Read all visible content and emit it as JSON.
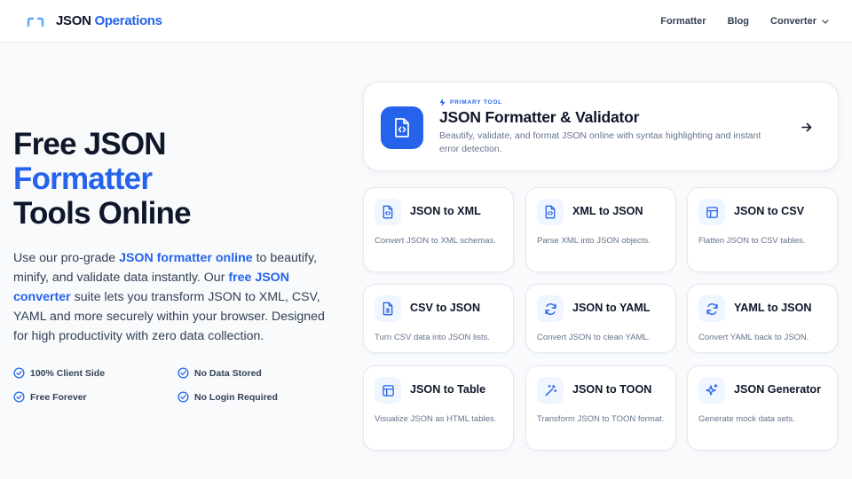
{
  "header": {
    "logo": {
      "prefix": "JSON",
      "accent": "Operations"
    },
    "nav": [
      {
        "label": "Formatter"
      },
      {
        "label": "Blog"
      },
      {
        "label": "Converter"
      }
    ]
  },
  "hero": {
    "title_line1": "Free JSON",
    "title_line2": "Formatter",
    "title_line3": "Tools Online",
    "desc_1": "Use our pro-grade ",
    "desc_link1": "JSON formatter online",
    "desc_2": " to beautify, minify, and validate data instantly. Our ",
    "desc_link2": "free JSON converter",
    "desc_3": " suite lets you transform JSON to XML, CSV, YAML and more securely within your browser. Designed for high productivity with zero data collection.",
    "features": [
      "100% Client Side",
      "No Data Stored",
      "Free Forever",
      "No Login Required"
    ]
  },
  "primary_tool": {
    "tag": "PRIMARY TOOL",
    "title": "JSON Formatter & Validator",
    "description": "Beautify, validate, and format JSON online with syntax highlighting and instant error detection."
  },
  "tools": [
    {
      "title": "JSON to XML",
      "description": "Convert JSON to XML schemas.",
      "icon": "code-file-icon"
    },
    {
      "title": "XML to JSON",
      "description": "Parse XML into JSON objects.",
      "icon": "code-file-icon"
    },
    {
      "title": "JSON to CSV",
      "description": "Flatten JSON to CSV tables.",
      "icon": "table-icon"
    },
    {
      "title": "CSV to JSON",
      "description": "Turn CSV data into JSON lists.",
      "icon": "spreadsheet-file-icon"
    },
    {
      "title": "JSON to YAML",
      "description": "Convert JSON to clean YAML.",
      "icon": "refresh-icon"
    },
    {
      "title": "YAML to JSON",
      "description": "Convert YAML back to JSON.",
      "icon": "refresh-icon"
    },
    {
      "title": "JSON to Table",
      "description": "Visualize JSON as HTML tables.",
      "icon": "table-icon"
    },
    {
      "title": "JSON to TOON",
      "description": "Transform JSON to TOON format.",
      "icon": "magic-wand-icon"
    },
    {
      "title": "JSON Generator",
      "description": "Generate mock data sets.",
      "icon": "sparkles-icon"
    }
  ],
  "colors": {
    "accent": "#2563eb",
    "text": "#0f172a",
    "muted": "#64748b",
    "background": "#f8fafc"
  }
}
